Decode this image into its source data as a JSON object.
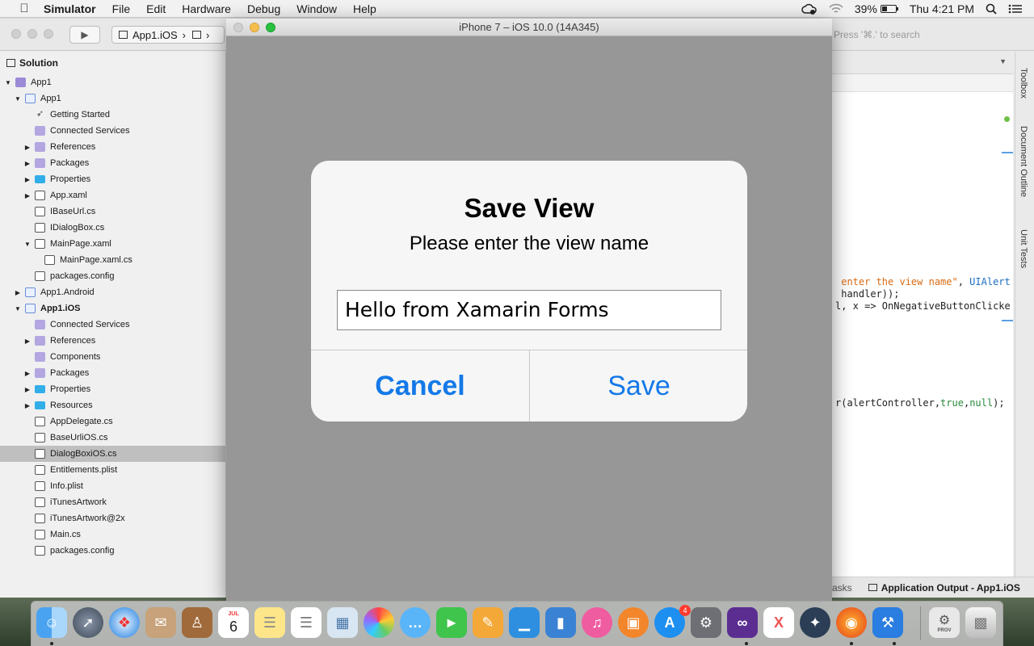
{
  "menubar": {
    "app_name": "Simulator",
    "menus": [
      "File",
      "Edit",
      "Hardware",
      "Debug",
      "Window",
      "Help"
    ],
    "battery_percent": "39%",
    "battery_level": 0.39,
    "clock": "Thu 4:21 PM"
  },
  "ide": {
    "config_label": "App1.iOS",
    "search_placeholder": "Press '⌘.' to search",
    "solution_title": "Solution",
    "tree": [
      {
        "label": "App1",
        "depth": 0,
        "arrow": "▼",
        "icon": "sol"
      },
      {
        "label": "App1",
        "depth": 1,
        "arrow": "▼",
        "icon": "proj"
      },
      {
        "label": "Getting Started",
        "depth": 2,
        "arrow": "",
        "icon": "rocket"
      },
      {
        "label": "Connected Services",
        "depth": 2,
        "arrow": "",
        "icon": "refs"
      },
      {
        "label": "References",
        "depth": 2,
        "arrow": "▶",
        "icon": "refs"
      },
      {
        "label": "Packages",
        "depth": 2,
        "arrow": "▶",
        "icon": "refs"
      },
      {
        "label": "Properties",
        "depth": 2,
        "arrow": "▶",
        "icon": "folder"
      },
      {
        "label": "App.xaml",
        "depth": 2,
        "arrow": "▶",
        "icon": "file"
      },
      {
        "label": "IBaseUrl.cs",
        "depth": 2,
        "arrow": "",
        "icon": "file"
      },
      {
        "label": "IDialogBox.cs",
        "depth": 2,
        "arrow": "",
        "icon": "file"
      },
      {
        "label": "MainPage.xaml",
        "depth": 2,
        "arrow": "▼",
        "icon": "file"
      },
      {
        "label": "MainPage.xaml.cs",
        "depth": 3,
        "arrow": "",
        "icon": "file"
      },
      {
        "label": "packages.config",
        "depth": 2,
        "arrow": "",
        "icon": "file"
      },
      {
        "label": "App1.Android",
        "depth": 1,
        "arrow": "▶",
        "icon": "proj"
      },
      {
        "label": "App1.iOS",
        "depth": 1,
        "arrow": "▼",
        "icon": "proj",
        "bold": true
      },
      {
        "label": "Connected Services",
        "depth": 2,
        "arrow": "",
        "icon": "refs"
      },
      {
        "label": "References",
        "depth": 2,
        "arrow": "▶",
        "icon": "refs"
      },
      {
        "label": "Components",
        "depth": 2,
        "arrow": "",
        "icon": "refs"
      },
      {
        "label": "Packages",
        "depth": 2,
        "arrow": "▶",
        "icon": "refs"
      },
      {
        "label": "Properties",
        "depth": 2,
        "arrow": "▶",
        "icon": "folder"
      },
      {
        "label": "Resources",
        "depth": 2,
        "arrow": "▶",
        "icon": "folder"
      },
      {
        "label": "AppDelegate.cs",
        "depth": 2,
        "arrow": "",
        "icon": "file"
      },
      {
        "label": "BaseUrliOS.cs",
        "depth": 2,
        "arrow": "",
        "icon": "file"
      },
      {
        "label": "DialogBoxiOS.cs",
        "depth": 2,
        "arrow": "",
        "icon": "file",
        "selected": true
      },
      {
        "label": "Entitlements.plist",
        "depth": 2,
        "arrow": "",
        "icon": "file"
      },
      {
        "label": "Info.plist",
        "depth": 2,
        "arrow": "",
        "icon": "file"
      },
      {
        "label": "iTunesArtwork",
        "depth": 2,
        "arrow": "",
        "icon": "file"
      },
      {
        "label": "iTunesArtwork@2x",
        "depth": 2,
        "arrow": "",
        "icon": "file"
      },
      {
        "label": "Main.cs",
        "depth": 2,
        "arrow": "",
        "icon": "file"
      },
      {
        "label": "packages.config",
        "depth": 2,
        "arrow": "",
        "icon": "file"
      }
    ],
    "code": {
      "line1_str": " enter the view name\"",
      "line1_rest": ", ",
      "line1_type": "UIAlert",
      "line2": " handler));",
      "line3": "l, x => OnNegativeButtonClicke",
      "line4_pre": "r(alertController,",
      "line4_kw1": "true",
      "line4_sep": ",",
      "line4_kw2": "null",
      "line4_end": ");"
    },
    "dock_tabs": [
      "Toolbox",
      "Document Outline",
      "Unit Tests"
    ],
    "bottom_tasks": "asks",
    "bottom_output": "Application Output - App1.iOS"
  },
  "simulator": {
    "window_title": "iPhone 7 – iOS 10.0 (14A345)",
    "alert": {
      "title": "Save View",
      "message": "Please enter the view name",
      "input_value": "Hello from Xamarin Forms",
      "cancel_label": "Cancel",
      "save_label": "Save"
    }
  },
  "dock": {
    "calendar_month": "JUL",
    "calendar_day": "6",
    "appstore_badge": "4",
    "prov_label": "PROV"
  }
}
